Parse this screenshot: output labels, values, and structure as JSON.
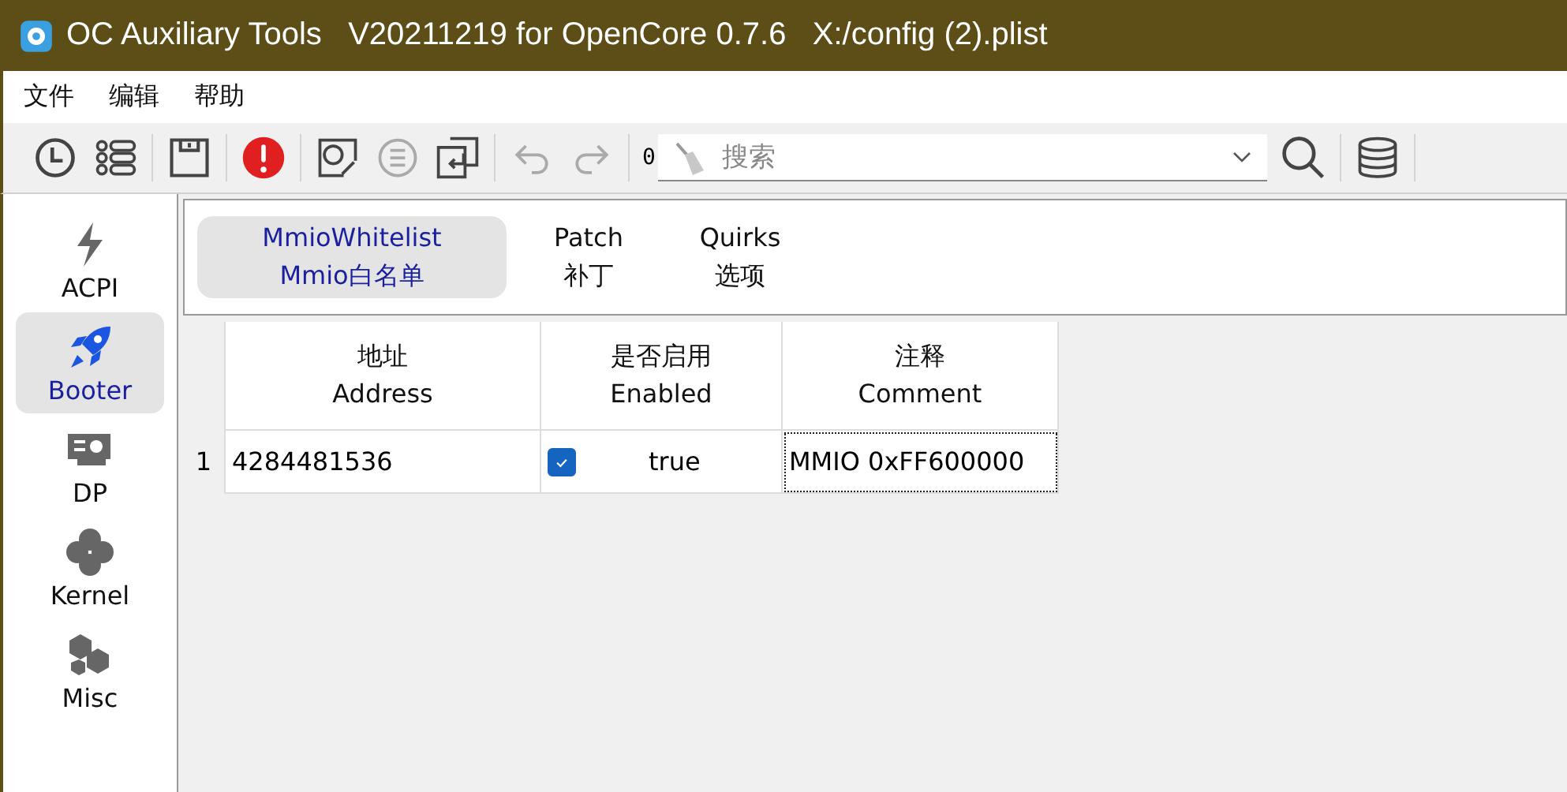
{
  "window": {
    "title": "OC Auxiliary Tools   V20211219 for OpenCore 0.7.6   X:/config (2).plist"
  },
  "menu": [
    "文件",
    "编辑",
    "帮助"
  ],
  "toolbar": {
    "counter": "0",
    "search": {
      "placeholder": "搜索"
    }
  },
  "sidebar": {
    "items": [
      {
        "label": "ACPI",
        "selected": false
      },
      {
        "label": "Booter",
        "selected": true
      },
      {
        "label": "DP",
        "selected": false
      },
      {
        "label": "Kernel",
        "selected": false
      },
      {
        "label": "Misc",
        "selected": false
      }
    ]
  },
  "tabs": [
    {
      "label": "MmioWhitelist",
      "sublabel": "Mmio白名单",
      "selected": true
    },
    {
      "label": "Patch",
      "sublabel": "补丁",
      "selected": false
    },
    {
      "label": "Quirks",
      "sublabel": "选项",
      "selected": false
    }
  ],
  "table": {
    "columns": [
      {
        "label": "地址",
        "sublabel": "Address"
      },
      {
        "label": "是否启用",
        "sublabel": "Enabled"
      },
      {
        "label": "注释",
        "sublabel": "Comment"
      }
    ],
    "rows": [
      {
        "number": "1",
        "address": "4284481536",
        "checked": true,
        "enabled": "true",
        "comment": "MMIO 0xFF600000",
        "comment_focused": true
      }
    ]
  }
}
